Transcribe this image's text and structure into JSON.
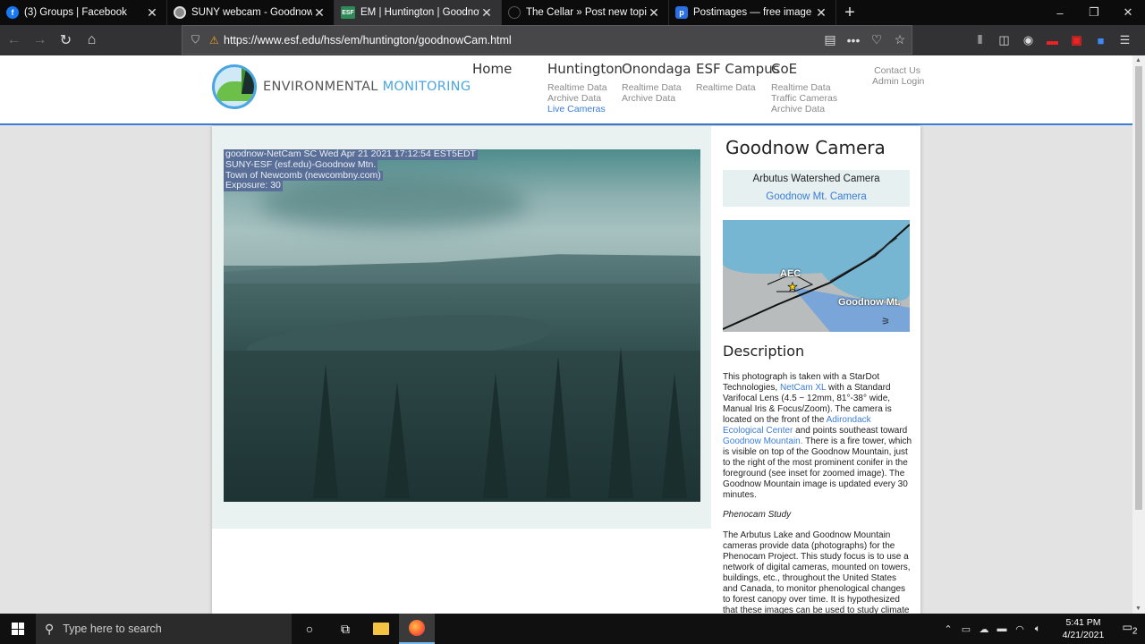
{
  "browser": {
    "tabs": [
      {
        "title": "(3) Groups | Facebook",
        "icon": "facebook-icon"
      },
      {
        "title": "SUNY webcam - Goodnow Mo",
        "icon": "suny-icon"
      },
      {
        "title": "EM | Huntington | Goodnow Ca",
        "icon": "esf-icon"
      },
      {
        "title": "The Cellar » Post new topic",
        "icon": "cellar-icon"
      },
      {
        "title": "Postimages — free image hosti",
        "icon": "postimages-icon"
      }
    ],
    "active_tab": 2,
    "url": "https://www.esf.edu/hss/em/huntington/goodnowCam.html",
    "favicon_labels": {
      "facebook": "f",
      "esf": "ESF",
      "postimages": "p"
    },
    "window_controls": {
      "minimize": "–",
      "restore": "❐",
      "close": "✕"
    }
  },
  "site": {
    "logo_text_1": "ENVIRONMENTAL ",
    "logo_text_2": "MONITORING",
    "nav": [
      {
        "heading": "Home",
        "links": []
      },
      {
        "heading": "Huntington",
        "links": [
          "Realtime Data",
          "Archive Data",
          "Live Cameras"
        ]
      },
      {
        "heading": "Onondaga",
        "links": [
          "Realtime Data",
          "Archive Data"
        ]
      },
      {
        "heading": "ESF Campus",
        "links": [
          "Realtime Data"
        ]
      },
      {
        "heading": "CoE",
        "links": [
          "Realtime Data",
          "Traffic Cameras",
          "Archive Data"
        ]
      }
    ],
    "contact_links": [
      "Contact Us",
      "Admin Login"
    ]
  },
  "webcam": {
    "overlay": [
      "goodnow-NetCam SC Wed Apr 21 2021 17:12:54 EST5EDT",
      "SUNY-ESF (esf.edu)-Goodnow Mtn.",
      "Town of Newcomb (newcombny.com)",
      "Exposure: 30"
    ]
  },
  "sidebar": {
    "title": "Goodnow Camera",
    "camera_link_1": "Arbutus Watershed Camera",
    "camera_link_2": "Goodnow Mt. Camera",
    "map_labels": {
      "aec": "AEC",
      "mountain": "Goodnow Mt."
    },
    "description_heading": "Description",
    "description": {
      "p1": "This photograph is taken with a StarDot Technologies, ",
      "link_netcam": "NetCam XL",
      "p2": " with a Standard Varifocal Lens (4.5 ~ 12mm, 81°-38° wide, Manual Iris & Focus/Zoom). The camera is located on the front of the ",
      "link_aec": "Adirondack Ecological Center",
      "p3": " and points southeast toward ",
      "link_goodnow": "Goodnow Mountain.",
      "p4": " There is a fire tower, which is visible on top of the Goodnow Mountain, just to the right of the most prominent conifer in the foreground (see inset for zoomed image). The Goodnow Mountain image is updated every 30 minutes."
    },
    "phenocam_heading": "Phenocam Study",
    "phenocam_text": "The Arbutus Lake and Goodnow Mountain cameras provide data (photographs) for the Phenocam Project. This study focus is to use a network of digital cameras, mounted on towers, buildings, etc., throughout the United States and Canada, to monitor phenological changes to forest canopy over time. It is hypothesized that these images can be used to study climate change, specifically, to quantify"
  },
  "taskbar": {
    "search_placeholder": "Type here to search",
    "time": "5:41 PM",
    "date": "4/21/2021",
    "notification_count": "2"
  }
}
